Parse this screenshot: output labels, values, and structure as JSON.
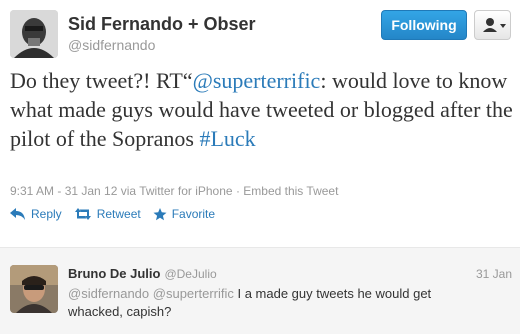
{
  "tweet": {
    "author_name": "Sid Fernando + Obser",
    "author_handle": "@sidfernando",
    "follow_label": "Following",
    "text_prefix": "Do they tweet?! RT“",
    "mention": "@superterrific",
    "text_body": ": would love to know what made guys would have tweeted or blogged after the pilot of the Sopranos ",
    "hashtag": "#Luck",
    "timestamp": "9:31 AM - 31 Jan 12",
    "via": "via Twitter for iPhone",
    "separator": "·",
    "embed_label": "Embed this Tweet",
    "actions": {
      "reply": "Reply",
      "retweet": "Retweet",
      "favorite": "Favorite"
    }
  },
  "reply": {
    "author_name": "Bruno De Julio",
    "author_handle": "@DeJulio",
    "date": "31 Jan",
    "mention_1": "@sidfernando",
    "mention_2": "@superterrific",
    "text": " I a made guy tweets he would get whacked, capish?"
  },
  "colors": {
    "link": "#2b7bb9",
    "follow_button": "#2486c8",
    "muted": "#999999"
  },
  "icons": [
    "user-menu-icon",
    "reply-icon",
    "retweet-icon",
    "favorite-icon"
  ]
}
